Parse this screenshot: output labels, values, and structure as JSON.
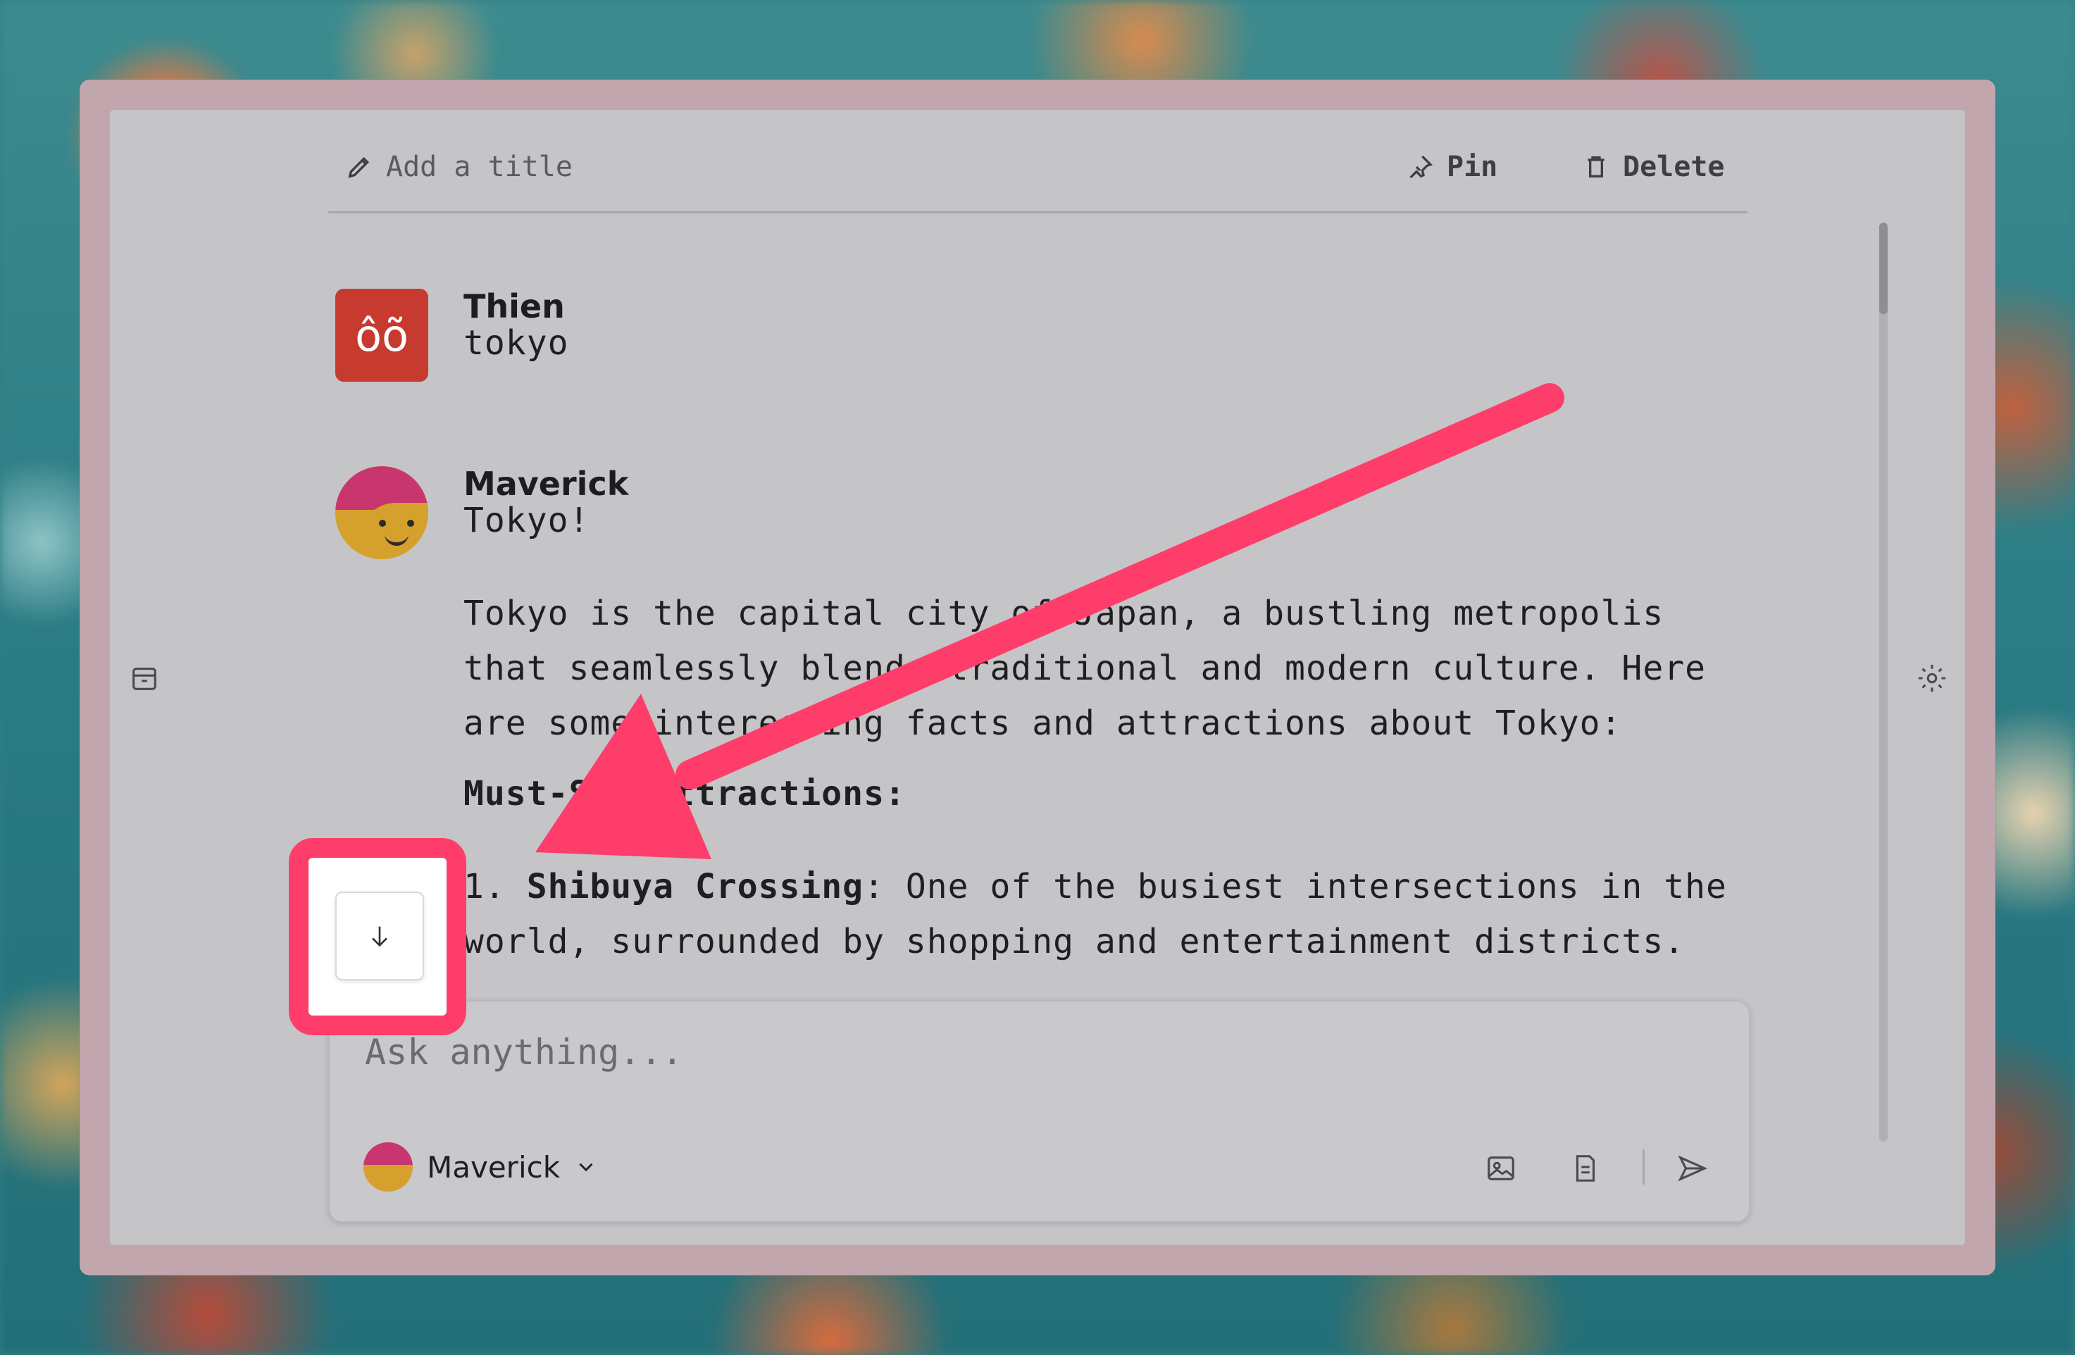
{
  "header": {
    "title_placeholder": "Add a title",
    "pin_label": "Pin",
    "delete_label": "Delete"
  },
  "messages": [
    {
      "author": "Thien",
      "avatar_text": "ôõ",
      "text": "tokyo"
    },
    {
      "author": "Maverick",
      "greeting": "Tokyo!",
      "paragraph": "Tokyo is the capital city of Japan, a bustling metropolis that seamlessly blends traditional and modern culture. Here are some interesting facts and attractions about Tokyo:",
      "section_heading": "Must-See Attractions:",
      "list": [
        {
          "number": "1.",
          "title": "Shibuya Crossing",
          "desc": ": One of the busiest intersections in the world, surrounded by shopping and entertainment districts."
        }
      ]
    }
  ],
  "composer": {
    "placeholder": "Ask anything...",
    "model_name": "Maverick"
  },
  "icons": {
    "archive": "archive-icon",
    "settings": "settings-icon",
    "scroll_down": "arrow-down-icon",
    "image": "image-icon",
    "file": "file-icon",
    "send": "send-icon"
  },
  "colors": {
    "annotation": "#ff3d6a",
    "thien_avatar": "#c63a2f",
    "maverick_face": "#d6a02c",
    "maverick_cap": "#c9356f"
  }
}
